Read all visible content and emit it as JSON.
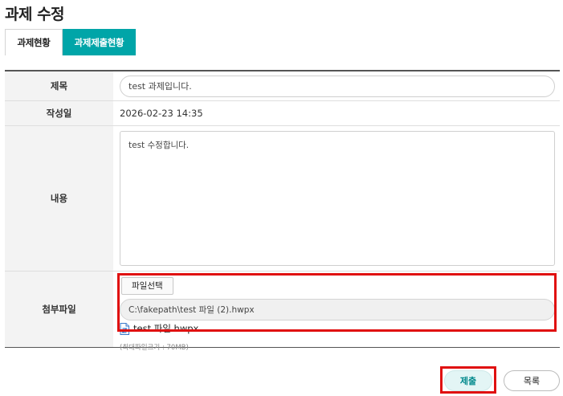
{
  "page": {
    "title": "과제 수정"
  },
  "tabs": [
    {
      "label": "과제현황",
      "active": false
    },
    {
      "label": "과제제출현황",
      "active": true
    }
  ],
  "form": {
    "title": {
      "label": "제목",
      "value": "test 과제입니다."
    },
    "date": {
      "label": "작성일",
      "value": "2026-02-23 14:35"
    },
    "content": {
      "label": "내용",
      "value": "test 수정합니다."
    },
    "attachment": {
      "label": "첨부파일",
      "select_button": "파일선택",
      "path": "C:\\fakepath\\test 파일 (2).hwpx",
      "existing_file": "test 파일.hwpx",
      "limit": "(최대파일크기 : 70MB)"
    }
  },
  "actions": {
    "submit": "제출",
    "list": "목록"
  },
  "colors": {
    "accent": "#00a5a8",
    "highlight": "#e01010"
  },
  "icons": {
    "file": "hwpx-file-icon"
  }
}
